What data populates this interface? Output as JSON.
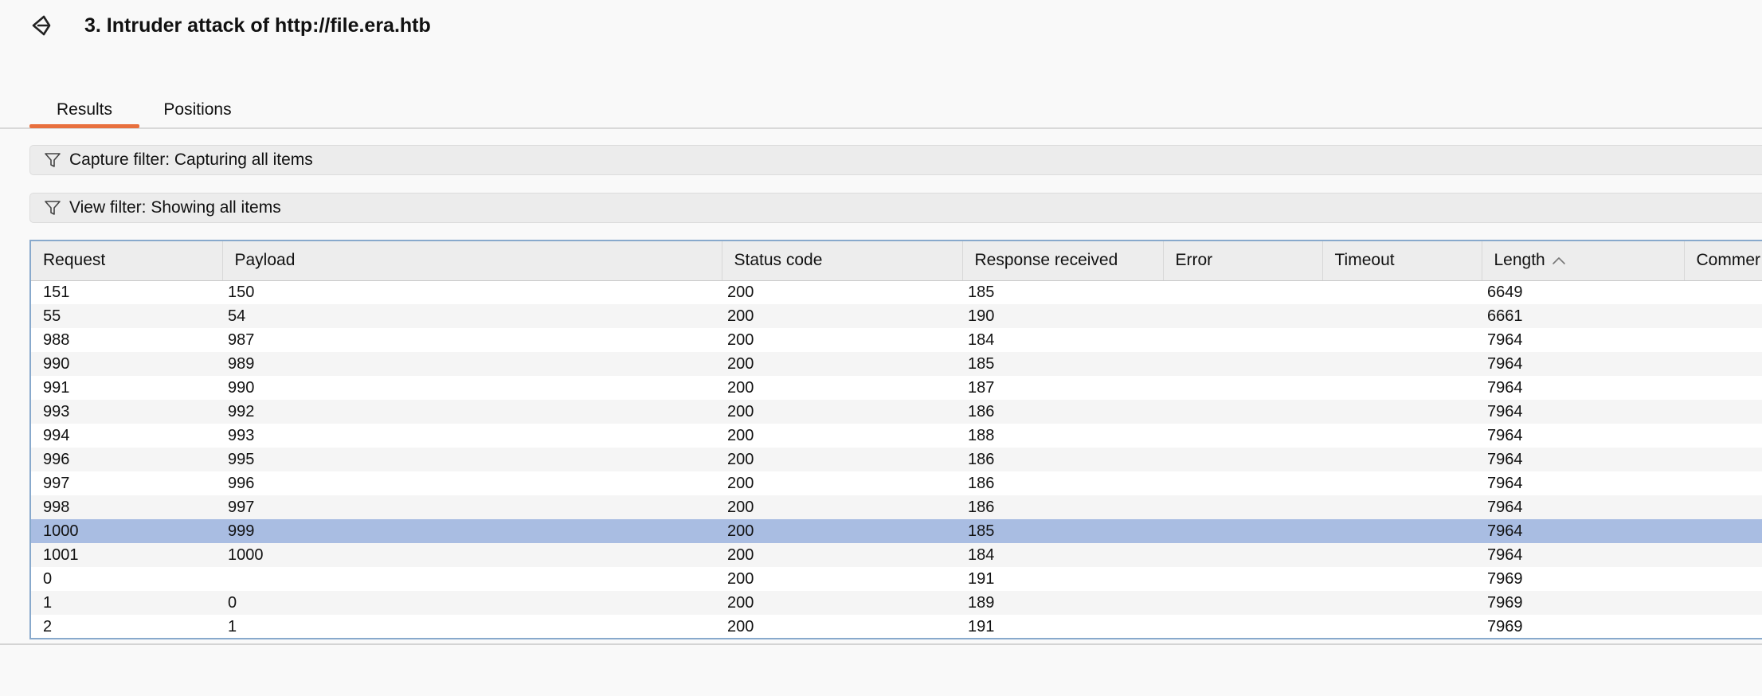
{
  "header": {
    "title": "3. Intruder attack of http://file.era.htb",
    "back_icon": "back-arrow-icon"
  },
  "tabs": [
    {
      "label": "Results",
      "active": true
    },
    {
      "label": "Positions",
      "active": false
    }
  ],
  "filters": {
    "capture": "Capture filter: Capturing all items",
    "view": "View filter: Showing all items"
  },
  "table": {
    "columns": [
      "Request",
      "Payload",
      "Status code",
      "Response received",
      "Error",
      "Timeout",
      "Length",
      "Commer"
    ],
    "sorted_column": "Length",
    "sort_direction": "ascending",
    "rows": [
      [
        "151",
        "150",
        "200",
        "185",
        "",
        "",
        "6649",
        ""
      ],
      [
        "55",
        "54",
        "200",
        "190",
        "",
        "",
        "6661",
        ""
      ],
      [
        "988",
        "987",
        "200",
        "184",
        "",
        "",
        "7964",
        ""
      ],
      [
        "990",
        "989",
        "200",
        "185",
        "",
        "",
        "7964",
        ""
      ],
      [
        "991",
        "990",
        "200",
        "187",
        "",
        "",
        "7964",
        ""
      ],
      [
        "993",
        "992",
        "200",
        "186",
        "",
        "",
        "7964",
        ""
      ],
      [
        "994",
        "993",
        "200",
        "188",
        "",
        "",
        "7964",
        ""
      ],
      [
        "996",
        "995",
        "200",
        "186",
        "",
        "",
        "7964",
        ""
      ],
      [
        "997",
        "996",
        "200",
        "186",
        "",
        "",
        "7964",
        ""
      ],
      [
        "998",
        "997",
        "200",
        "186",
        "",
        "",
        "7964",
        ""
      ],
      [
        "1000",
        "999",
        "200",
        "185",
        "",
        "",
        "7964",
        ""
      ],
      [
        "1001",
        "1000",
        "200",
        "184",
        "",
        "",
        "7964",
        ""
      ],
      [
        "0",
        "",
        "200",
        "191",
        "",
        "",
        "7969",
        ""
      ],
      [
        "1",
        "0",
        "200",
        "189",
        "",
        "",
        "7969",
        ""
      ],
      [
        "2",
        "1",
        "200",
        "191",
        "",
        "",
        "7969",
        ""
      ]
    ],
    "selected_row": 10
  },
  "colors": {
    "accent": "#e8703e",
    "selection": "#a9bde2",
    "table_border": "#88a9cc"
  }
}
